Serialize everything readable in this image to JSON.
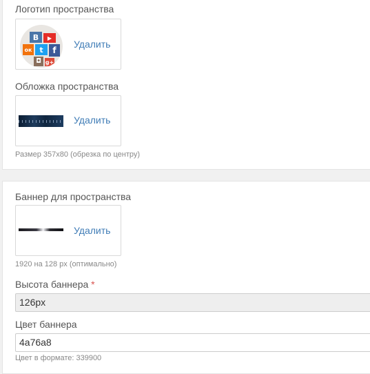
{
  "space_settings": {
    "logo": {
      "label": "Логотип пространства",
      "delete_label": "Удалить",
      "icons": [
        "vk-icon",
        "youtube-icon",
        "odnoklassniki-icon",
        "twitter-icon",
        "facebook-icon",
        "google-plus-icon",
        "instagram-icon"
      ],
      "icon_glyphs": {
        "vk": "В",
        "youtube": "▶",
        "ok": "ок",
        "twitter": "t",
        "facebook": "f",
        "gplus": "g+",
        "instagram": "◘"
      },
      "colors": {
        "vk": "#4a76a8",
        "youtube": "#e52d27",
        "ok": "#f2720c",
        "twitter": "#1da1f2",
        "facebook": "#3b5998",
        "gplus": "#dd4b39",
        "instagram": "#8a6f5c"
      }
    },
    "cover": {
      "label": "Обложка пространства",
      "delete_label": "Удалить",
      "hint": "Размер 357х80 (обрезка по центру)"
    }
  },
  "banner_settings": {
    "banner": {
      "label": "Баннер для пространства",
      "delete_label": "Удалить",
      "hint": "1920 на 128 px (оптимально)"
    },
    "height": {
      "label": "Высота баннера",
      "required_mark": "*",
      "value": "126px"
    },
    "color": {
      "label": "Цвет баннера",
      "value": "4a76a8",
      "hint": "Цвет в формате: 339900"
    }
  },
  "colors": {
    "link": "#3f7cb6",
    "required": "#d9534f"
  }
}
